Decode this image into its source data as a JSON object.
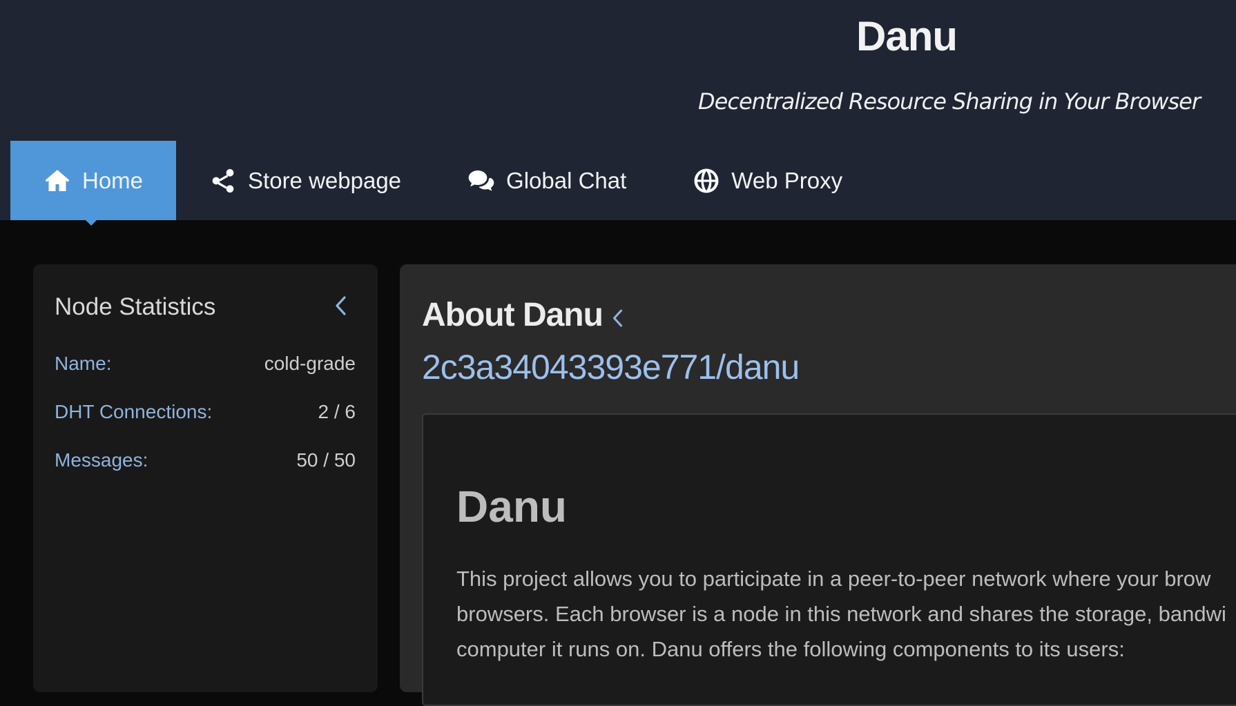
{
  "header": {
    "title": "Danu",
    "subtitle": "Decentralized Resource Sharing in Your Browser"
  },
  "nav": {
    "items": [
      {
        "label": "Home",
        "icon": "home-icon",
        "active": true
      },
      {
        "label": "Store webpage",
        "icon": "share-icon",
        "active": false
      },
      {
        "label": "Global Chat",
        "icon": "chat-icon",
        "active": false
      },
      {
        "label": "Web Proxy",
        "icon": "globe-icon",
        "active": false
      }
    ]
  },
  "stats": {
    "title": "Node Statistics",
    "rows": [
      {
        "label": "Name:",
        "value": "cold-grade"
      },
      {
        "label": "DHT Connections:",
        "value": "2 / 6"
      },
      {
        "label": "Messages:",
        "value": "50 / 50"
      }
    ]
  },
  "about": {
    "title": "About Danu",
    "repo": "2c3a34043393e771/danu",
    "heading": "Danu",
    "paragraph_lines": [
      "This project allows you to participate in a peer-to-peer network where your brow",
      "browsers. Each browser is a node in this network and shares the storage, bandwi",
      "computer it runs on. Danu offers the following components to its users:"
    ]
  },
  "colors": {
    "header_bg": "#1f2533",
    "accent": "#4f97d9",
    "link": "#9cc0ec",
    "label": "#8fb3de"
  }
}
